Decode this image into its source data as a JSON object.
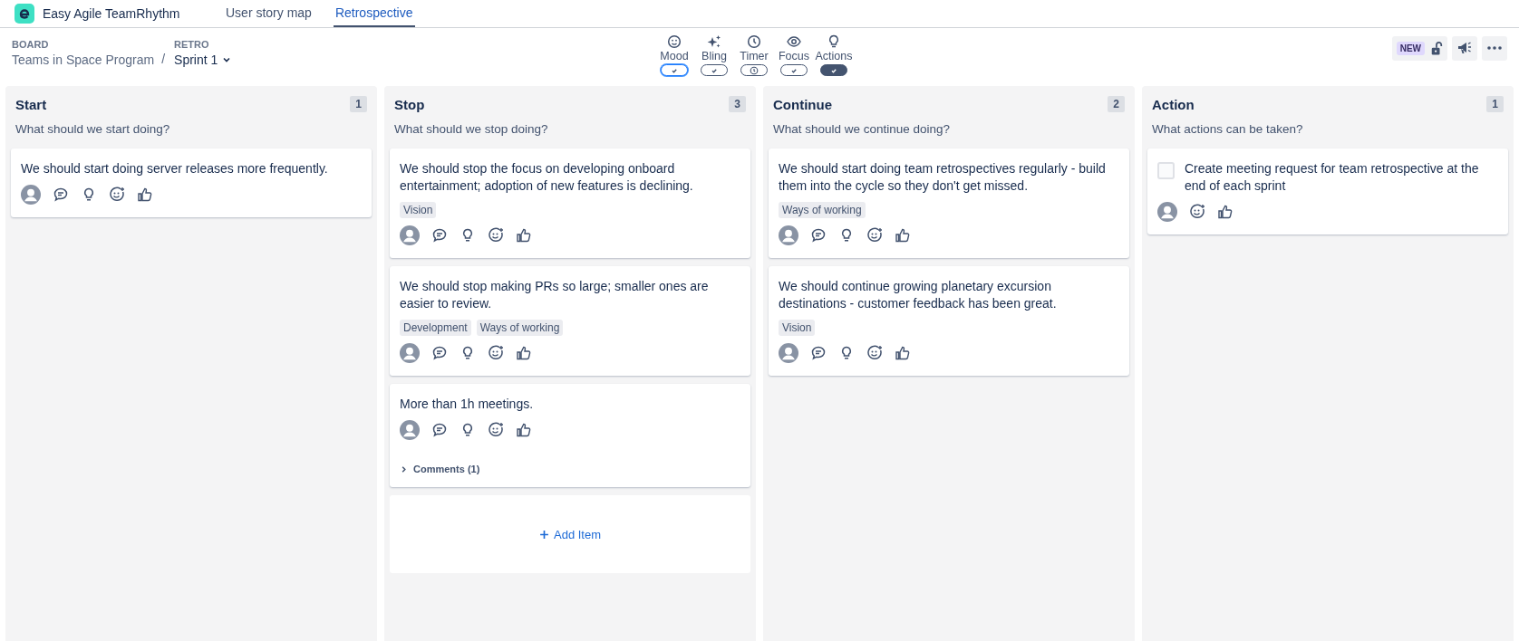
{
  "app": {
    "name": "Easy Agile TeamRhythm"
  },
  "tabs": [
    {
      "label": "User story map",
      "selected": false
    },
    {
      "label": "Retrospective",
      "selected": true
    }
  ],
  "breadcrumb": {
    "board_label": "BOARD",
    "board": "Teams in Space Program",
    "separator": "/",
    "retro_label": "RETRO",
    "retro": "Sprint 1"
  },
  "tools": [
    {
      "kind": "mood",
      "label": "Mood",
      "on": false,
      "focused": true
    },
    {
      "kind": "bling",
      "label": "Bling",
      "on": false,
      "focused": false
    },
    {
      "kind": "timer",
      "label": "Timer",
      "on": false,
      "focused": false
    },
    {
      "kind": "focus",
      "label": "Focus",
      "on": false,
      "focused": false
    },
    {
      "kind": "actions",
      "label": "Actions",
      "on": true,
      "focused": false
    }
  ],
  "new_badge": "NEW",
  "columns": [
    {
      "title": "Start",
      "count": "1",
      "prompt": "What should we start doing?",
      "cards": [
        {
          "kind": "item",
          "text": "We should start doing server releases more frequently."
        }
      ]
    },
    {
      "title": "Stop",
      "count": "3",
      "prompt": "What should we stop doing?",
      "add_item": "Add Item",
      "cards": [
        {
          "kind": "item",
          "text": "We should stop the focus on developing onboard entertainment; adoption of new features is declining.",
          "tags": [
            "Vision"
          ]
        },
        {
          "kind": "item",
          "text": "We should stop making PRs so large; smaller ones are easier to review.",
          "tags": [
            "Development",
            "Ways of working"
          ]
        },
        {
          "kind": "item",
          "text": "More than 1h meetings.",
          "comments": "Comments (1)"
        }
      ]
    },
    {
      "title": "Continue",
      "count": "2",
      "prompt": "What should we continue doing?",
      "cards": [
        {
          "kind": "item",
          "text": "We should start doing team retrospectives regularly - build them into the cycle so they don't get missed.",
          "tags": [
            "Ways of working"
          ]
        },
        {
          "kind": "item",
          "text": "We should continue growing planetary excursion destinations - customer feedback has been great.",
          "tags": [
            "Vision"
          ]
        }
      ]
    },
    {
      "title": "Action",
      "count": "1",
      "prompt": "What actions can be taken?",
      "cards": [
        {
          "kind": "action",
          "checked": false,
          "text": "Create meeting request for team retrospective at the end of each sprint"
        }
      ]
    }
  ]
}
